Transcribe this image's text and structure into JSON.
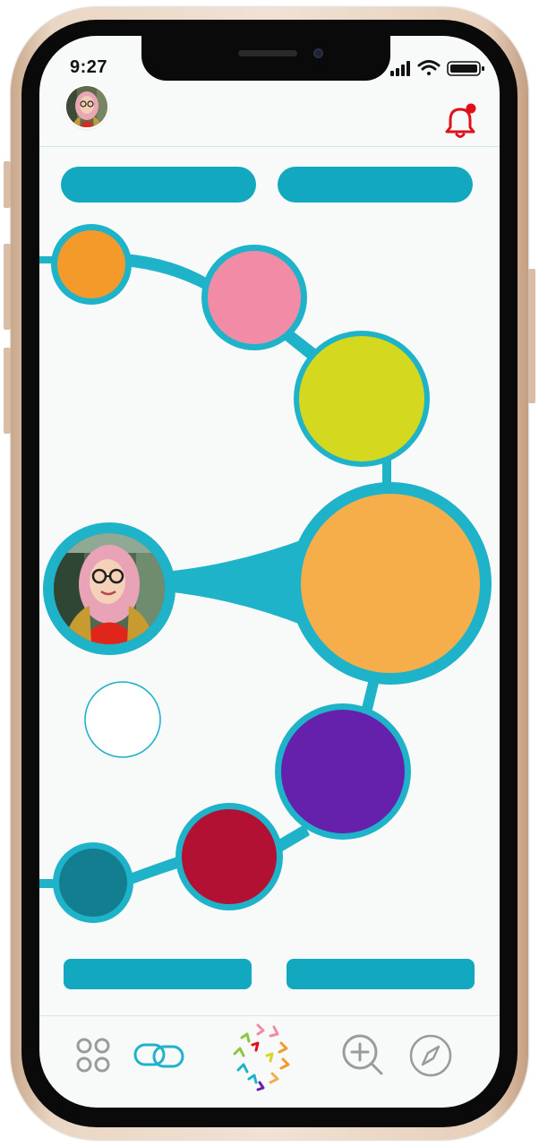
{
  "status_bar": {
    "time": "9:27",
    "icons": [
      "signal-icon",
      "wifi-icon",
      "battery-icon"
    ]
  },
  "header": {
    "avatar": "profile-avatar",
    "notification_icon": "bell-icon",
    "notification_badge": true
  },
  "top_buttons": [
    "pill-button-left",
    "pill-button-right"
  ],
  "graph": {
    "center_node": "profile-photo",
    "empty_node": "empty-circle",
    "connector_color": "#1fb3c9",
    "nodes": [
      {
        "name": "orange-small",
        "color": "#f39a2b"
      },
      {
        "name": "pink",
        "color": "#f28ba6"
      },
      {
        "name": "yellow-green",
        "color": "#d4d81f"
      },
      {
        "name": "orange-large",
        "color": "#f5ae49"
      },
      {
        "name": "purple",
        "color": "#6521ab"
      },
      {
        "name": "crimson",
        "color": "#b31134"
      },
      {
        "name": "teal-dark",
        "color": "#127e90"
      }
    ]
  },
  "bottom_buttons": [
    "pill-button-bottom-left",
    "pill-button-bottom-right"
  ],
  "tab_bar": {
    "items": [
      "grid-icon",
      "link-icon",
      "logo-icon",
      "zoom-in-icon",
      "compass-icon"
    ]
  },
  "colors": {
    "accent": "#12a8c0",
    "bell": "#e0101b",
    "screen_bg": "#f8f9f9",
    "icon_grey": "#9b9b9b"
  }
}
